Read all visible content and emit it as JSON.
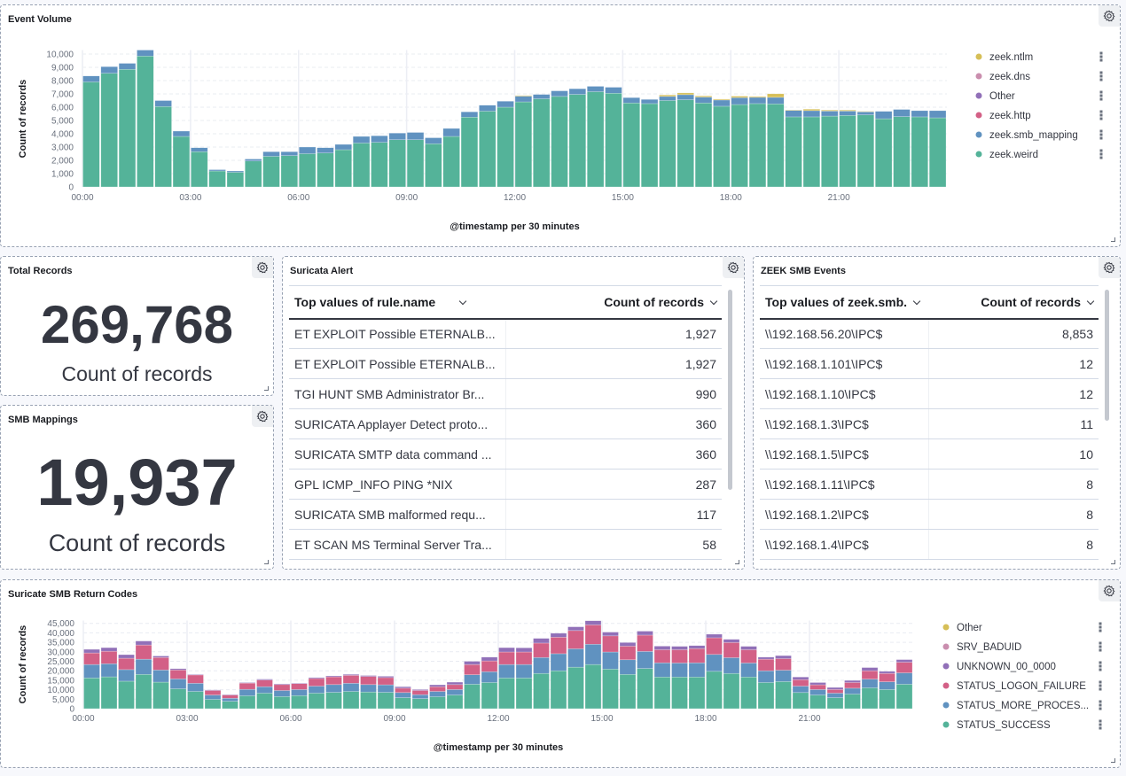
{
  "colors": {
    "weird": "#54B399",
    "smb_mapping": "#6092C0",
    "http": "#D36086",
    "other": "#9170B8",
    "dns": "#CA8EAE",
    "ntlm": "#D6BF57"
  },
  "event_volume": {
    "title": "Event Volume"
  },
  "total_records": {
    "title": "Total Records",
    "value": "269,768",
    "label": "Count of records"
  },
  "smb_mappings": {
    "title": "SMB Mappings",
    "value": "19,937",
    "label": "Count of records"
  },
  "suricata_alert": {
    "title": "Suricata Alert",
    "col1": "Top values of rule.name",
    "col2": "Count of records",
    "rows": [
      [
        "ET EXPLOIT Possible ETERNALB...",
        "1,927"
      ],
      [
        "ET EXPLOIT Possible ETERNALB...",
        "1,927"
      ],
      [
        "TGI HUNT SMB Administrator Br...",
        "990"
      ],
      [
        "SURICATA Applayer Detect proto...",
        "360"
      ],
      [
        "SURICATA SMTP data command ...",
        "360"
      ],
      [
        "GPL ICMP_INFO PING *NIX",
        "287"
      ],
      [
        "SURICATA SMB malformed requ...",
        "117"
      ],
      [
        "ET SCAN MS Terminal Server Tra...",
        "58"
      ]
    ]
  },
  "zeek_smb": {
    "title": "ZEEK SMB Events",
    "col1": "Top values of zeek.smb.",
    "col2": "Count of records",
    "rows": [
      [
        "\\\\192.168.56.20\\IPC$",
        "8,853"
      ],
      [
        "\\\\192.168.1.101\\IPC$",
        "12"
      ],
      [
        "\\\\192.168.1.10\\IPC$",
        "12"
      ],
      [
        "\\\\192.168.1.3\\IPC$",
        "11"
      ],
      [
        "\\\\192.168.1.5\\IPC$",
        "10"
      ],
      [
        "\\\\192.168.1.11\\IPC$",
        "8"
      ],
      [
        "\\\\192.168.1.2\\IPC$",
        "8"
      ],
      [
        "\\\\192.168.1.4\\IPC$",
        "8"
      ]
    ]
  },
  "return_codes": {
    "title": "Suricate SMB Return Codes"
  },
  "chart_data": [
    {
      "type": "bar",
      "stacked": true,
      "title": "Event Volume",
      "xlabel": "@timestamp per 30 minutes",
      "ylabel": "Count of records",
      "ylim": [
        0,
        10300
      ],
      "yticks": [
        0,
        1000,
        2000,
        3000,
        4000,
        5000,
        6000,
        7000,
        8000,
        9000,
        10000
      ],
      "ytick_labels": [
        "0",
        "1,000",
        "2,000",
        "3,000",
        "4,000",
        "5,000",
        "6,000",
        "7,000",
        "8,000",
        "9,000",
        "10,000"
      ],
      "xtick_labels": [
        "00:00",
        "03:00",
        "06:00",
        "09:00",
        "12:00",
        "15:00",
        "18:00",
        "21:00"
      ],
      "interval": "30m",
      "bars": 48,
      "grid": true,
      "legend": "right",
      "legend_order": [
        "zeek.ntlm",
        "zeek.dns",
        "Other",
        "zeek.http",
        "zeek.smb_mapping",
        "zeek.weird"
      ],
      "series": [
        {
          "name": "zeek.weird",
          "color": "#54B399",
          "values": [
            7900,
            8550,
            8850,
            9850,
            6050,
            3800,
            2650,
            1200,
            1100,
            1950,
            2300,
            2350,
            2500,
            2550,
            2800,
            3300,
            3350,
            3550,
            3550,
            3250,
            3800,
            5250,
            5700,
            6000,
            6400,
            6630,
            6810,
            6960,
            7165,
            7050,
            6320,
            6270,
            6500,
            6560,
            6320,
            6070,
            6200,
            6270,
            6250,
            5270,
            5270,
            5330,
            5380,
            5420,
            5130,
            5290,
            5270,
            5200
          ]
        },
        {
          "name": "zeek.smb_mapping",
          "color": "#6092C0",
          "values": [
            450,
            500,
            450,
            450,
            450,
            400,
            300,
            100,
            100,
            150,
            350,
            300,
            500,
            400,
            400,
            500,
            500,
            500,
            550,
            450,
            600,
            400,
            450,
            450,
            430,
            330,
            420,
            430,
            405,
            450,
            400,
            315,
            310,
            380,
            440,
            470,
            520,
            470,
            490,
            490,
            470,
            380,
            330,
            230,
            560,
            540,
            470,
            540
          ]
        },
        {
          "name": "zeek.http",
          "color": "#D36086",
          "values": []
        },
        {
          "name": "Other",
          "color": "#9170B8",
          "values": []
        },
        {
          "name": "zeek.dns",
          "color": "#CA8EAE",
          "values": []
        },
        {
          "name": "zeek.ntlm",
          "color": "#D6BF57",
          "values": [
            0,
            0,
            0,
            0,
            0,
            0,
            0,
            0,
            0,
            0,
            0,
            0,
            0,
            0,
            0,
            0,
            0,
            0,
            0,
            0,
            0,
            0,
            0,
            0,
            50,
            0,
            0,
            0,
            0,
            0,
            0,
            0,
            110,
            135,
            90,
            70,
            110,
            70,
            270,
            40,
            110,
            70,
            70,
            40,
            0,
            0,
            0,
            0
          ]
        }
      ]
    },
    {
      "type": "bar",
      "stacked": true,
      "title": "Suricate SMB Return Codes",
      "xlabel": "@timestamp per 30 minutes",
      "ylabel": "Count of records",
      "ylim": [
        0,
        46500
      ],
      "yticks": [
        0,
        5000,
        10000,
        15000,
        20000,
        25000,
        30000,
        35000,
        40000,
        45000
      ],
      "ytick_labels": [
        "0",
        "5,000",
        "10,000",
        "15,000",
        "20,000",
        "25,000",
        "30,000",
        "35,000",
        "40,000",
        "45,000"
      ],
      "xtick_labels": [
        "00:00",
        "03:00",
        "06:00",
        "09:00",
        "12:00",
        "15:00",
        "18:00",
        "21:00"
      ],
      "interval": "30m",
      "bars": 48,
      "grid": true,
      "legend": "right",
      "legend_order": [
        "Other",
        "SRV_BADUID",
        "UNKNOWN_00_0000",
        "STATUS_LOGON_FAILURE",
        "STATUS_MORE_PROCES...",
        "STATUS_SUCCESS"
      ],
      "series": [
        {
          "name": "STATUS_SUCCESS",
          "color": "#54B399",
          "values": [
            16200,
            16800,
            14500,
            18100,
            14000,
            10500,
            9100,
            4900,
            3900,
            6800,
            8200,
            6400,
            6900,
            8200,
            8600,
            9100,
            8800,
            8600,
            5800,
            5300,
            6300,
            7200,
            12900,
            13800,
            16200,
            16200,
            18600,
            20000,
            21900,
            23300,
            20900,
            18100,
            21200,
            16700,
            16700,
            16700,
            19700,
            18600,
            16700,
            13800,
            14300,
            8500,
            7200,
            5800,
            7700,
            11000,
            10100,
            12900
          ]
        },
        {
          "name": "STATUS_MORE_PROCES...",
          "color": "#6092C0",
          "values": [
            7100,
            6900,
            6100,
            8000,
            6400,
            5200,
            4300,
            2300,
            1600,
            3400,
            3400,
            3200,
            3200,
            3700,
            4100,
            4300,
            3900,
            4000,
            2700,
            2100,
            2800,
            2900,
            5000,
            5700,
            7100,
            7100,
            8400,
            9000,
            9700,
            10700,
            9000,
            7700,
            9000,
            7500,
            7400,
            7500,
            8900,
            8300,
            7400,
            6200,
            6000,
            3400,
            2900,
            2400,
            3100,
            4600,
            4100,
            6000
          ]
        },
        {
          "name": "STATUS_LOGON_FAILURE",
          "color": "#D36086",
          "values": [
            6100,
            6600,
            6000,
            7500,
            6600,
            4700,
            4400,
            2400,
            1700,
            3300,
            3500,
            3100,
            3100,
            4000,
            4100,
            4200,
            4300,
            3800,
            2300,
            2200,
            2500,
            2600,
            5400,
            5700,
            6600,
            6600,
            7600,
            8700,
            9600,
            10200,
            8500,
            7200,
            8600,
            6900,
            7000,
            7500,
            8800,
            8000,
            7000,
            6100,
            6100,
            3400,
            2500,
            1900,
            3000,
            4400,
            4400,
            5600
          ]
        },
        {
          "name": "UNKNOWN_00_0000",
          "color": "#9170B8",
          "values": [
            1900,
            1900,
            1900,
            2100,
            800,
            700,
            300,
            300,
            300,
            300,
            500,
            400,
            300,
            500,
            500,
            500,
            500,
            700,
            800,
            500,
            1000,
            1300,
            1700,
            2000,
            2300,
            2200,
            2500,
            2100,
            2000,
            2200,
            2000,
            1900,
            2100,
            1900,
            1800,
            1600,
            1900,
            1700,
            1800,
            1100,
            1600,
            1400,
            1200,
            1100,
            1100,
            1700,
            1100,
            1400
          ]
        },
        {
          "name": "SRV_BADUID",
          "color": "#CA8EAE",
          "values": []
        },
        {
          "name": "Other",
          "color": "#D6BF57",
          "values": []
        }
      ]
    }
  ]
}
